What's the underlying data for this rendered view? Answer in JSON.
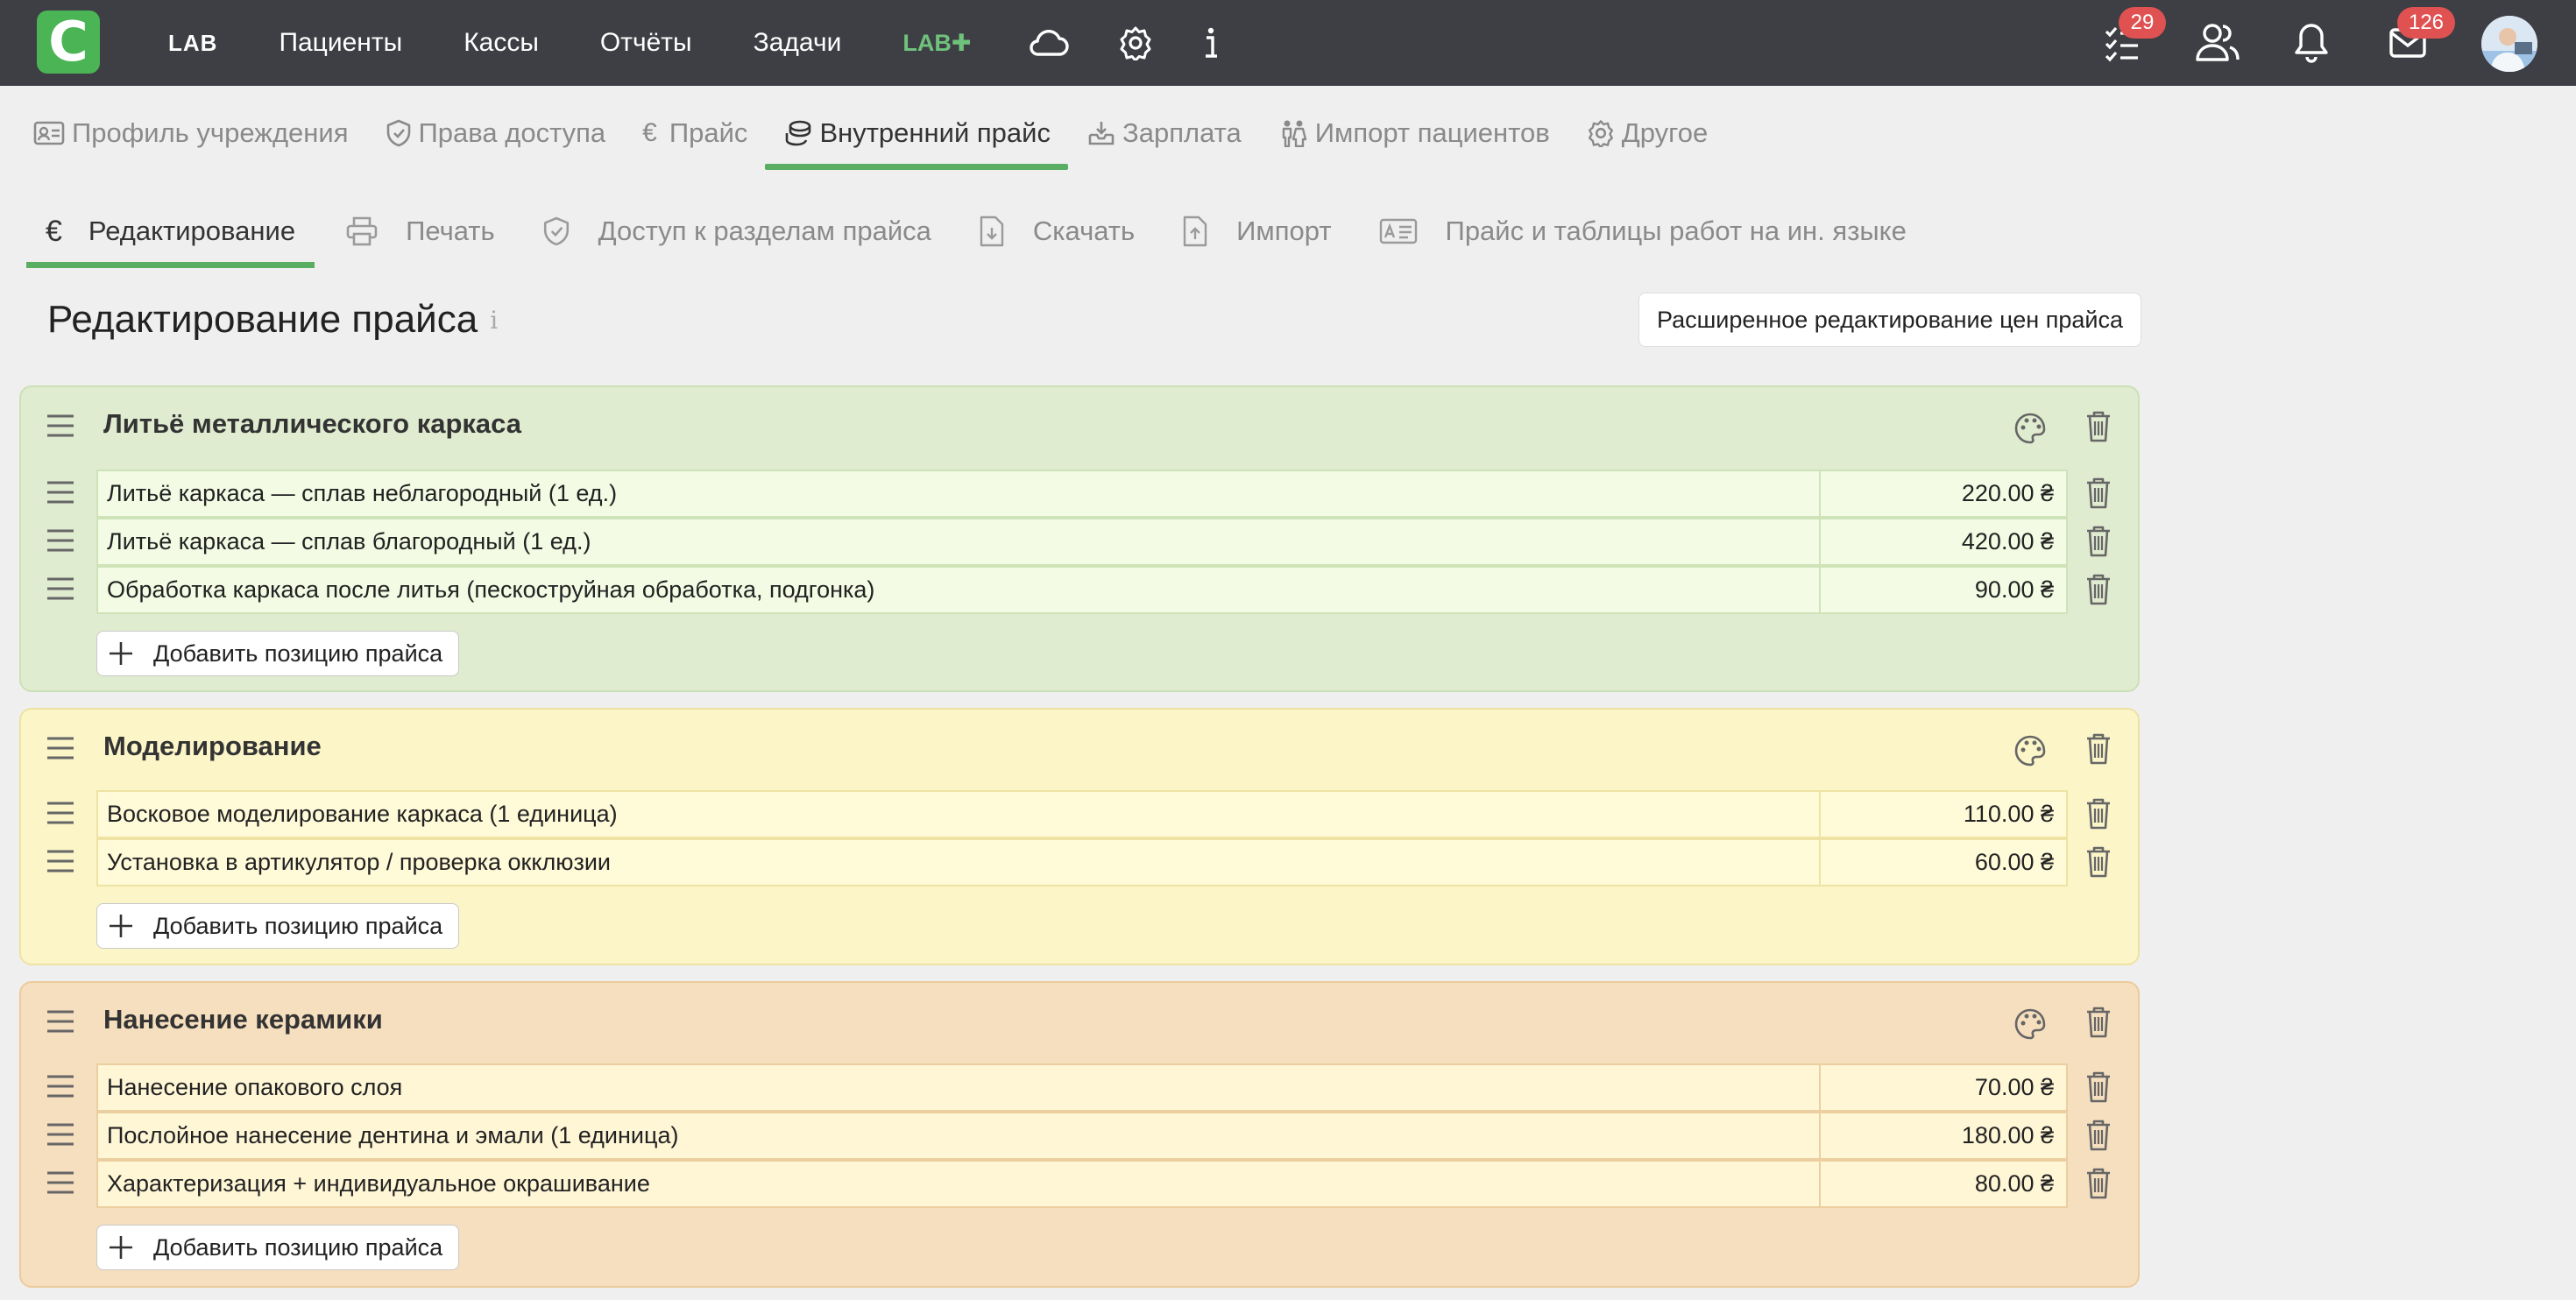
{
  "topbar": {
    "logo": "C",
    "brand": "LAB",
    "nav": [
      "Пациенты",
      "Кассы",
      "Отчёты",
      "Задачи"
    ],
    "labplus": "LAB✚",
    "icons": [
      "cloud-icon",
      "gear-icon",
      "info-icon"
    ],
    "tasks_badge": "29",
    "mail_badge": "126"
  },
  "settings_tabs": [
    {
      "label": "Профиль учреждения",
      "icon": "id-card-icon"
    },
    {
      "label": "Права доступа",
      "icon": "shield-icon"
    },
    {
      "label": "Прайс",
      "icon": "euro-icon"
    },
    {
      "label": "Внутренний прайс",
      "icon": "coins-icon",
      "active": true
    },
    {
      "label": "Зарплата",
      "icon": "inbox-download-icon"
    },
    {
      "label": "Импорт пациентов",
      "icon": "people-icon"
    },
    {
      "label": "Другое",
      "icon": "gear-icon"
    }
  ],
  "price_tabs": [
    {
      "label": "Редактирование",
      "icon": "euro-icon",
      "active": true
    },
    {
      "label": "Печать",
      "icon": "printer-icon"
    },
    {
      "label": "Доступ к разделам прайса",
      "icon": "shield-check-icon"
    },
    {
      "label": "Скачать",
      "icon": "file-download-icon"
    },
    {
      "label": "Импорт",
      "icon": "file-upload-icon"
    },
    {
      "label": "Прайс и таблицы работ на ин. языке",
      "icon": "language-card-icon"
    }
  ],
  "page": {
    "title": "Редактирование прайса",
    "info_icon": "i",
    "advanced_button": "Расширенное редактирование цен прайса",
    "add_item_label": "Добавить позицию прайса"
  },
  "groups": [
    {
      "title": "Литьё металлического каркаса",
      "color": "#e0ecd0",
      "items": [
        {
          "name": "Литьё каркаса — сплав неблагородный (1 ед.)",
          "price": "220.00 ₴"
        },
        {
          "name": "Литьё каркаса — сплав благородный (1 ед.)",
          "price": "420.00 ₴"
        },
        {
          "name": "Обработка каркаса после литья (пескоструйная обработка, подгонка)",
          "price": "90.00 ₴"
        }
      ]
    },
    {
      "title": "Моделирование",
      "color": "#fbf5c8",
      "items": [
        {
          "name": "Восковое моделирование каркаса (1 единица)",
          "price": "110.00 ₴"
        },
        {
          "name": "Установка в артикулятор / проверка окклюзии",
          "price": "60.00 ₴"
        }
      ]
    },
    {
      "title": "Нанесение керамики",
      "color": "#f6dfbe",
      "items": [
        {
          "name": "Нанесение опакового слоя",
          "price": "70.00 ₴"
        },
        {
          "name": "Послойное нанесение дентина и эмали (1 единица)",
          "price": "180.00 ₴"
        },
        {
          "name": "Характеризация + индивидуальное окрашивание",
          "price": "80.00 ₴"
        }
      ]
    }
  ]
}
